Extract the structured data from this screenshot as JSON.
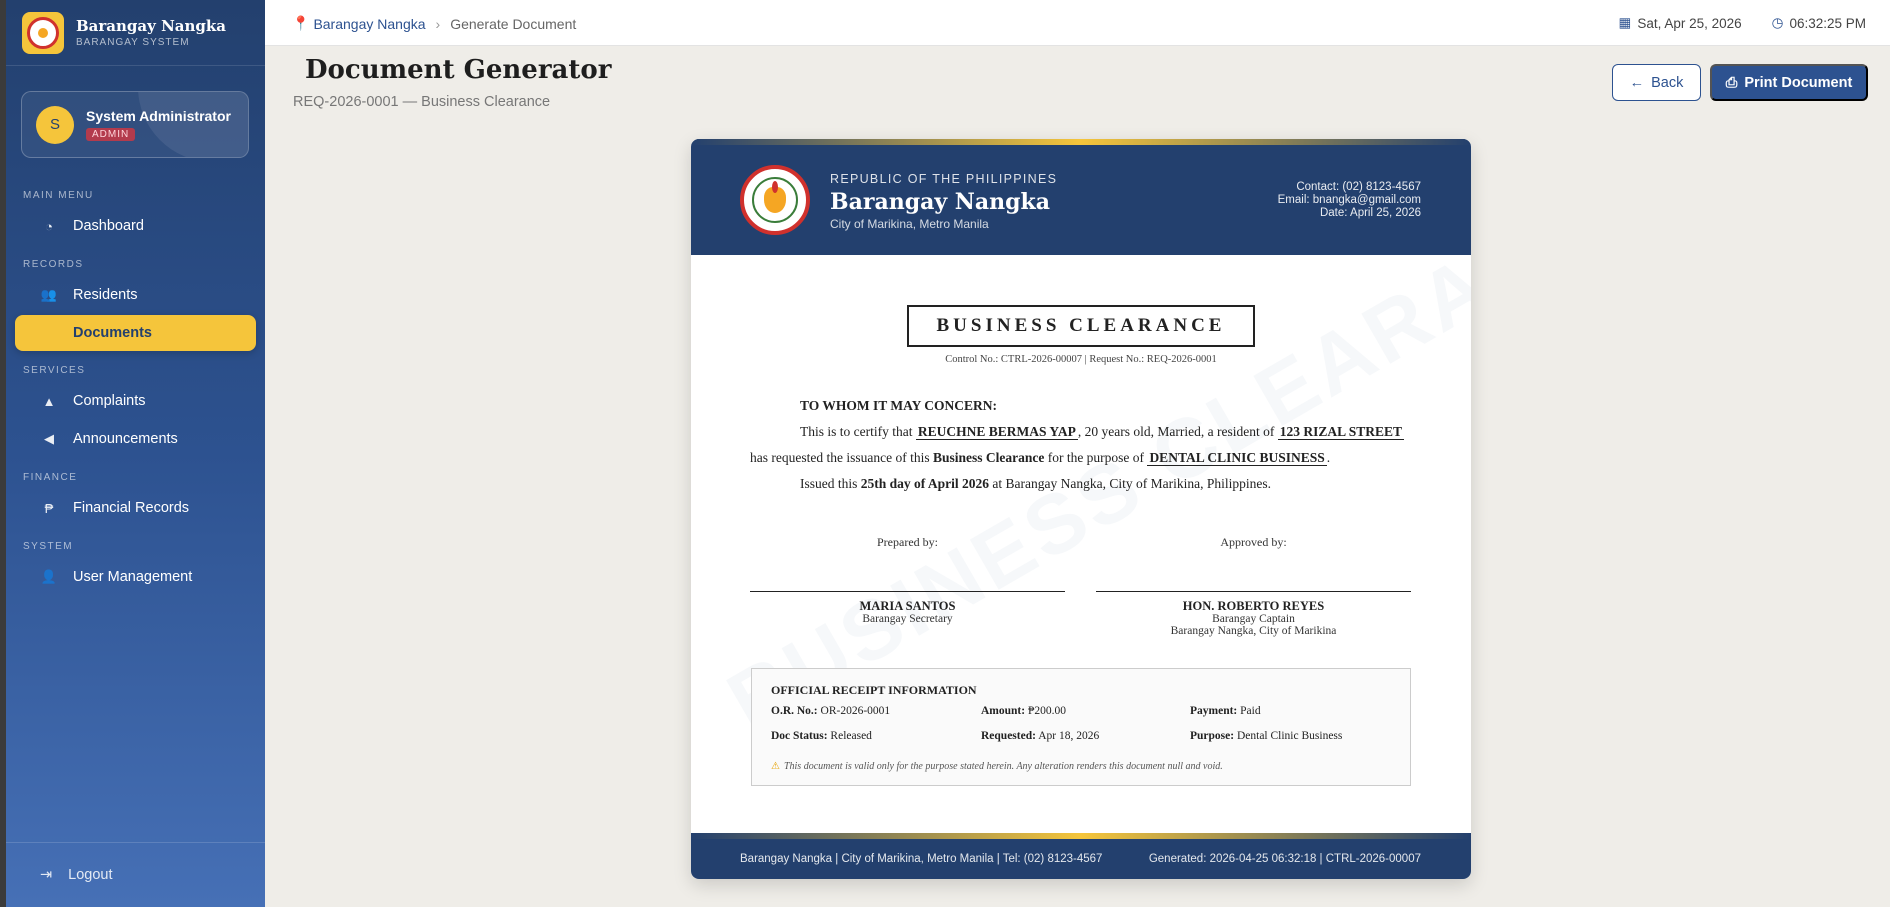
{
  "app": {
    "title": "Barangay Nangka",
    "subtitle": "BARANGAY SYSTEM"
  },
  "user": {
    "initial": "S",
    "name": "System Administrator",
    "role": "ADMIN"
  },
  "sidebar": {
    "sections": [
      "MAIN MENU",
      "RECORDS",
      "SERVICES",
      "FINANCE",
      "SYSTEM"
    ],
    "items": [
      {
        "label": "Dashboard",
        "icon": "dashboard-icon"
      },
      {
        "label": "Residents",
        "icon": "users-icon"
      },
      {
        "label": "Documents",
        "icon": "document-icon"
      },
      {
        "label": "Complaints",
        "icon": "warning-icon"
      },
      {
        "label": "Announcements",
        "icon": "megaphone-icon"
      },
      {
        "label": "Financial Records",
        "icon": "peso-icon"
      },
      {
        "label": "User Management",
        "icon": "user-gear-icon"
      }
    ],
    "active": "Documents",
    "logout": "Logout"
  },
  "topbar": {
    "breadcrumb_home": "Barangay Nangka",
    "breadcrumb_current": "Generate Document",
    "date": "Sat, Apr 25, 2026",
    "time": "06:32:25 PM"
  },
  "page": {
    "title": "Document Generator",
    "subtitle": "REQ-2026-0001 — Business Clearance",
    "back_label": "Back",
    "print_label": "Print Document"
  },
  "document": {
    "republic": "REPUBLIC OF THE PHILIPPINES",
    "barangay": "Barangay Nangka",
    "city": "City of Marikina, Metro Manila",
    "contact": "Contact: (02) 8123-4567",
    "email": "Email: bnangka@gmail.com",
    "date": "Date: April 25, 2026",
    "title": "BUSINESS CLEARANCE",
    "watermark": "BUSINESS CLEARANCE",
    "control": "Control No.: CTRL-2026-00007  |  Request No.: REQ-2026-0001",
    "salutation": "TO WHOM IT MAY CONCERN:",
    "body": {
      "p1_a": "This is to certify that",
      "name": "REUCHNE BERMAS YAP",
      "p1_b": ", 20 years old, Married, a resident of",
      "address": "123 RIZAL STREET",
      "p2_a": "has requested the issuance of this",
      "doc_type": "Business Clearance",
      "p2_b": "for the purpose of",
      "purpose": "DENTAL CLINIC BUSINESS",
      "p2_c": ".",
      "p3_a": "Issued this",
      "issued": "25th day of April 2026",
      "p3_b": "at Barangay Nangka, City of Marikina, Philippines."
    },
    "prepared_label": "Prepared by:",
    "approved_label": "Approved by:",
    "prepared_name": "MARIA SANTOS",
    "prepared_role": "Barangay Secretary",
    "approved_name": "HON. ROBERTO REYES",
    "approved_role": "Barangay Captain",
    "approved_role2": "Barangay Nangka, City of Marikina",
    "receipt": {
      "title": "OFFICIAL RECEIPT INFORMATION",
      "or_label": "O.R. No.:",
      "or_value": "OR-2026-0001",
      "amount_label": "Amount:",
      "amount_value": "₱200.00",
      "payment_label": "Payment:",
      "payment_value": "Paid",
      "status_label": "Doc Status:",
      "status_value": "Released",
      "requested_label": "Requested:",
      "requested_value": "Apr 18, 2026",
      "purpose_label": "Purpose:",
      "purpose_value": "Dental Clinic Business",
      "note": "This document is valid only for the purpose stated herein. Any alteration renders this document null and void."
    },
    "footer_left": "Barangay Nangka | City of Marikina, Metro Manila | Tel: (02) 8123-4567",
    "footer_right": "Generated: 2026-04-25 06:32:18 | CTRL-2026-00007"
  },
  "colors": {
    "primary": "#2d5290",
    "navy": "#23406e",
    "accent": "#f5c53b",
    "badge": "#b33b4d"
  }
}
